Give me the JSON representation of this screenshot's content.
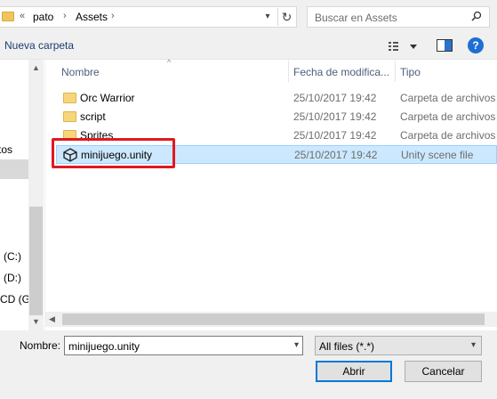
{
  "address": {
    "chevrons": "«",
    "crumbs": [
      "pato",
      "Assets"
    ],
    "separator": "›"
  },
  "search": {
    "placeholder": "Buscar en Assets"
  },
  "toolbar": {
    "new_folder": "Nueva carpeta",
    "help": "?"
  },
  "nav": {
    "items": [
      "tos",
      "l (C:)",
      "l (D:)",
      "CD (G"
    ]
  },
  "columns": {
    "name": "Nombre",
    "date": "Fecha de modifica...",
    "type": "Tipo"
  },
  "files": [
    {
      "name": "Orc Warrior",
      "date": "25/10/2017 19:42",
      "type": "Carpeta de archivos",
      "icon": "folder-icon"
    },
    {
      "name": "script",
      "date": "25/10/2017 19:42",
      "type": "Carpeta de archivos",
      "icon": "folder-icon"
    },
    {
      "name": "Sprites",
      "date": "25/10/2017 19:42",
      "type": "Carpeta de archivos",
      "icon": "folder-icon"
    },
    {
      "name": "minijuego.unity",
      "date": "25/10/2017 19:42",
      "type": "Unity scene file",
      "icon": "unity-icon"
    }
  ],
  "footer": {
    "filename_label": "Nombre:",
    "filename_value": "minijuego.unity",
    "filter_value": "All files (*.*)",
    "open_label": "Abrir",
    "cancel_label": "Cancelar"
  },
  "colors": {
    "accent": "#0078d7",
    "highlight": "#e0191f",
    "selected_row": "#cce8ff"
  }
}
